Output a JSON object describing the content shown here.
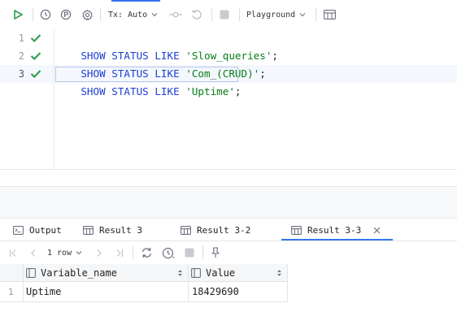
{
  "toolbar": {
    "tx_label": "Tx: Auto",
    "schema_label": "Playground",
    "accent_color": "#3574f0",
    "icons": [
      "run-icon",
      "history-icon",
      "pin-plan-icon",
      "settings-icon",
      "commit-icon",
      "rollback-icon",
      "stop-icon",
      "table-view-icon"
    ]
  },
  "editor": {
    "lines": [
      {
        "number": "1",
        "keyword": "SHOW STATUS LIKE ",
        "string": "'Slow_queries'",
        "end": ";"
      },
      {
        "number": "2",
        "keyword": "SHOW STATUS LIKE ",
        "string": "'Com_(CRUD)'",
        "end": ";"
      },
      {
        "number": "3",
        "keyword": "SHOW STATUS LIKE ",
        "string": "'Uptime'",
        "end": ";"
      }
    ],
    "keyword_color": "#1e3fd0",
    "string_color": "#067d17",
    "success_color": "#2e9d4f"
  },
  "result_tabs": [
    {
      "label": "Output"
    },
    {
      "label": "Result 3"
    },
    {
      "label": "Result 3-2"
    },
    {
      "label": "Result 3-3",
      "active": true
    }
  ],
  "result_toolbar": {
    "rows_label": "1 row"
  },
  "grid": {
    "columns": [
      "Variable_name",
      "Value"
    ],
    "rows": [
      {
        "row_number": "1",
        "cells": [
          "Uptime",
          "18429690"
        ]
      }
    ]
  }
}
